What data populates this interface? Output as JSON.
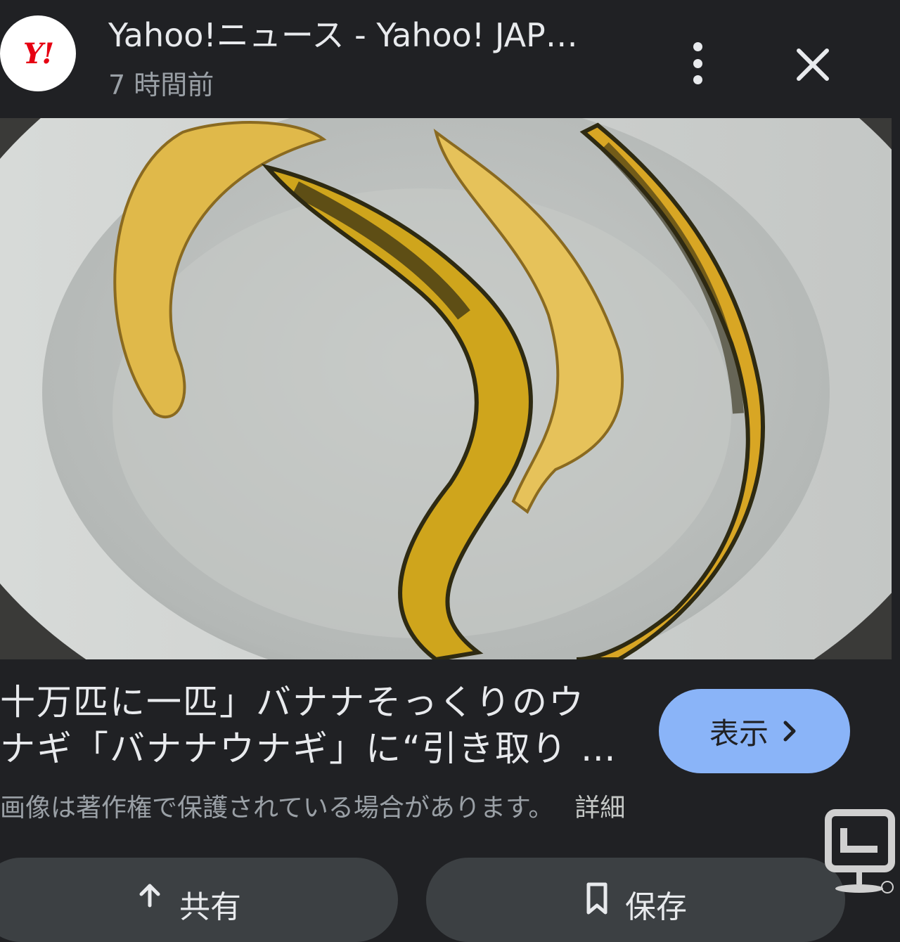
{
  "header": {
    "logo_text": "Y!",
    "source_title": "Yahoo!ニュース - Yahoo! JAP…",
    "time_ago": "7 時間前",
    "more_icon": "more-vert-icon",
    "close_icon": "close-icon"
  },
  "caption": {
    "line1": "十万匹に一匹」バナナそっくりのウ",
    "line2": "ナギ「バナナウナギ」に“引き取り …",
    "copyright_notice": "画像は著作権で保護されている場合があります。",
    "details_link": "詳細"
  },
  "actions": {
    "view_label": "表示",
    "share_label": "共有",
    "save_label": "保存"
  },
  "colors": {
    "background": "#202124",
    "accent_button": "#8ab4f8",
    "yahoo_red": "#e60012"
  }
}
